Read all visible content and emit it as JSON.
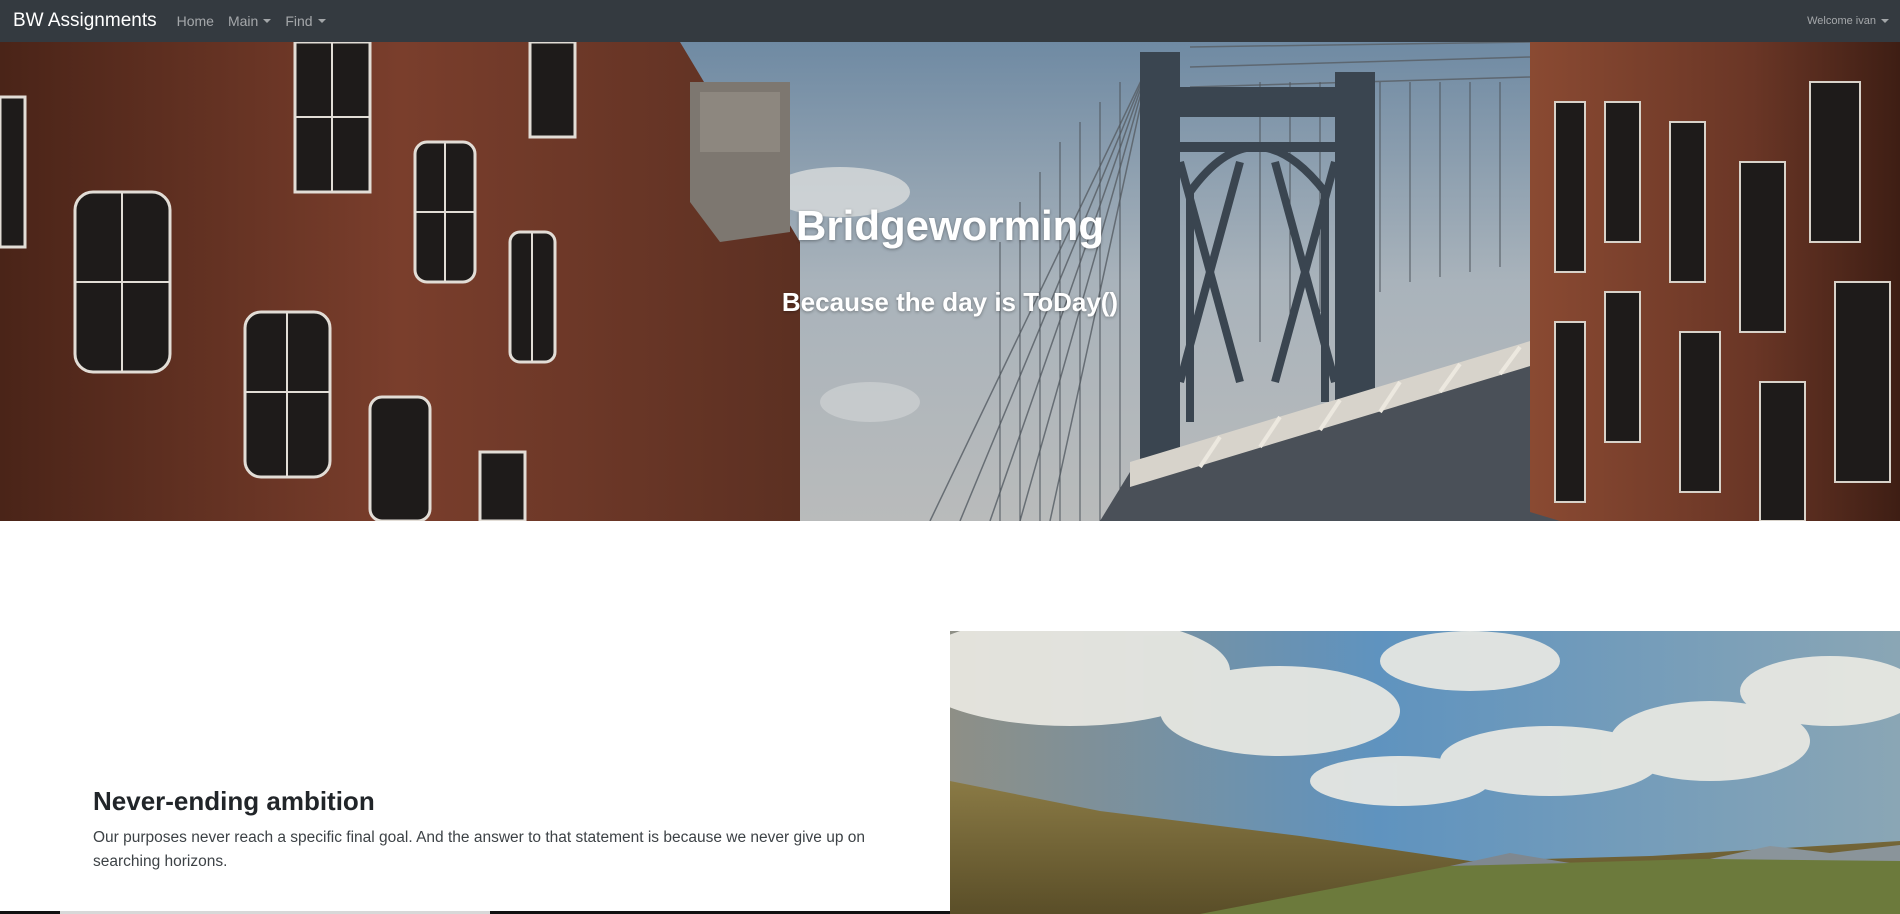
{
  "navbar": {
    "brand": "BW Assignments",
    "items": [
      {
        "label": "Home"
      },
      {
        "label": "Main"
      },
      {
        "label": "Find"
      }
    ],
    "user_menu": "Welcome ivan"
  },
  "hero": {
    "title": "Bridgeworming",
    "subtitle": "Because the day is ToDay()"
  },
  "feature": {
    "title": "Never-ending ambition",
    "text": "Our purposes never reach a specific final goal. And the answer to that statement is because we never give up on searching horizons."
  },
  "colors": {
    "navbar_bg": "#343a40",
    "brick": "#7a3e2c",
    "sky": "#6e9fc4"
  }
}
